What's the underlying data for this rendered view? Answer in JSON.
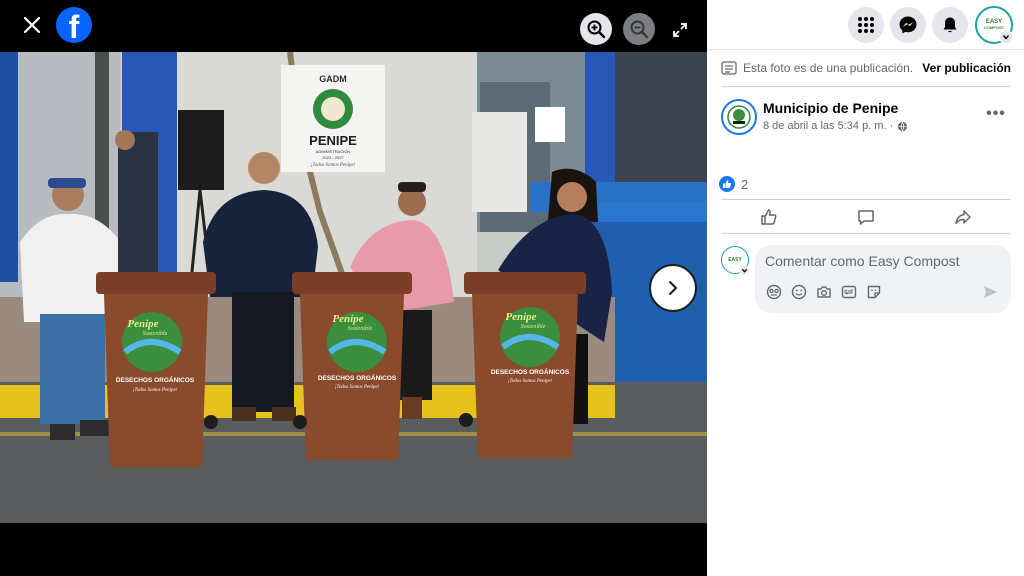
{
  "viewer": {
    "close_icon": "close-icon",
    "brand_icon": "facebook-logo",
    "brand_letter": "f",
    "zoom_in_icon": "zoom-in-icon",
    "zoom_out_icon": "zoom-out-icon",
    "fullscreen_icon": "fullscreen-icon",
    "next_icon": "chevron-right-icon",
    "photo": {
      "banner": {
        "top": "GADM",
        "name": "PENIPE",
        "admin": "ADMINISTRACIÓN",
        "years": "2023 - 2027",
        "motto": "¡Todos Somos Penipe!"
      },
      "bins": [
        {
          "brand_top": "Penipe",
          "brand_sub": "Sostenible",
          "label": "DESECHOS ORGÁNICOS",
          "motto": "¡Todos Somos Penipe!"
        },
        {
          "brand_top": "Penipe",
          "brand_sub": "Sostenible",
          "label": "DESECHOS ORGÁNICOS",
          "motto": "¡Todos Somos Penipe!"
        },
        {
          "brand_top": "Penipe",
          "brand_sub": "Sostenible",
          "label": "DESECHOS ORGÁNICOS",
          "motto": "¡Todos Somos Penipe!"
        }
      ]
    }
  },
  "header": {
    "menu_icon": "grid-menu-icon",
    "messenger_icon": "messenger-icon",
    "notifications_icon": "bell-icon",
    "profile": {
      "line1": "EASY",
      "line2": "COMPOST"
    }
  },
  "notice": {
    "text": "Esta foto es de una publicación.",
    "link": "Ver publicación"
  },
  "post": {
    "author": "Municipio de Penipe",
    "date": "8 de abril a las 5:34 p. m. ·",
    "privacy_icon": "globe-icon",
    "more_label": "•••",
    "reaction_count": "2",
    "actions": [
      {
        "icon": "like-icon"
      },
      {
        "icon": "comment-icon"
      },
      {
        "icon": "share-icon"
      }
    ]
  },
  "comment": {
    "placeholder": "Comentar como Easy Compost",
    "avatar": {
      "line1": "EASY",
      "line2": "COMPOST"
    }
  },
  "colors": {
    "facebook_blue": "#0866ff",
    "like_blue": "#1877f2",
    "bin_brown": "#8a4a2c",
    "bin_blue": "#1f5fae"
  }
}
